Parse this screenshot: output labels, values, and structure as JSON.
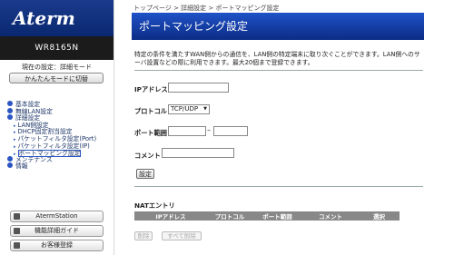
{
  "sidebar": {
    "logo": "Aterm",
    "model": "WR8165N",
    "mode_text": "現在の設定：詳細モード",
    "mode_button": "かんたんモードに切替",
    "nav": [
      {
        "label": "基本設定",
        "level": 0
      },
      {
        "label": "無線LAN設定",
        "level": 0
      },
      {
        "label": "詳細設定",
        "level": 0
      },
      {
        "label": "LAN側設定",
        "level": 1
      },
      {
        "label": "DHCP固定割当設定",
        "level": 1
      },
      {
        "label": "パケットフィルタ設定(Port)",
        "level": 1
      },
      {
        "label": "パケットフィルタ設定(IP)",
        "level": 1
      },
      {
        "label": "ポートマッピング設定",
        "level": 1,
        "current": true
      },
      {
        "label": "メンテナンス",
        "level": 0
      },
      {
        "label": "情報",
        "level": 0
      }
    ],
    "bottom_buttons": [
      "AtermStation",
      "機能詳細ガイド",
      "お客様登録"
    ]
  },
  "main": {
    "breadcrumb": "トップページ > 詳細設定 > ポートマッピング設定",
    "title": "ポートマッピング設定",
    "description": "特定の条件を満たすWAN側からの通信を、LAN側の特定端末に取り次ぐことができます。LAN側へのサーバ設置などの際に利用できます。最大20個まで登録できます。",
    "form": {
      "ip_label": "IPアドレス",
      "ip_value": "",
      "protocol_label": "プロトコル",
      "protocol_value": "TCP/UDP",
      "port_label": "ポート範囲",
      "port_from": "",
      "port_sep": "–",
      "port_to": "",
      "comment_label": "コメント",
      "comment_value": "",
      "set_button": "設定"
    },
    "nat": {
      "title": "NATエントリ",
      "columns": [
        "IPアドレス",
        "プロトコル",
        "ポート範囲",
        "コメント",
        "選択"
      ],
      "delete_button": "削除",
      "delete_all_button": "すべて削除"
    }
  }
}
